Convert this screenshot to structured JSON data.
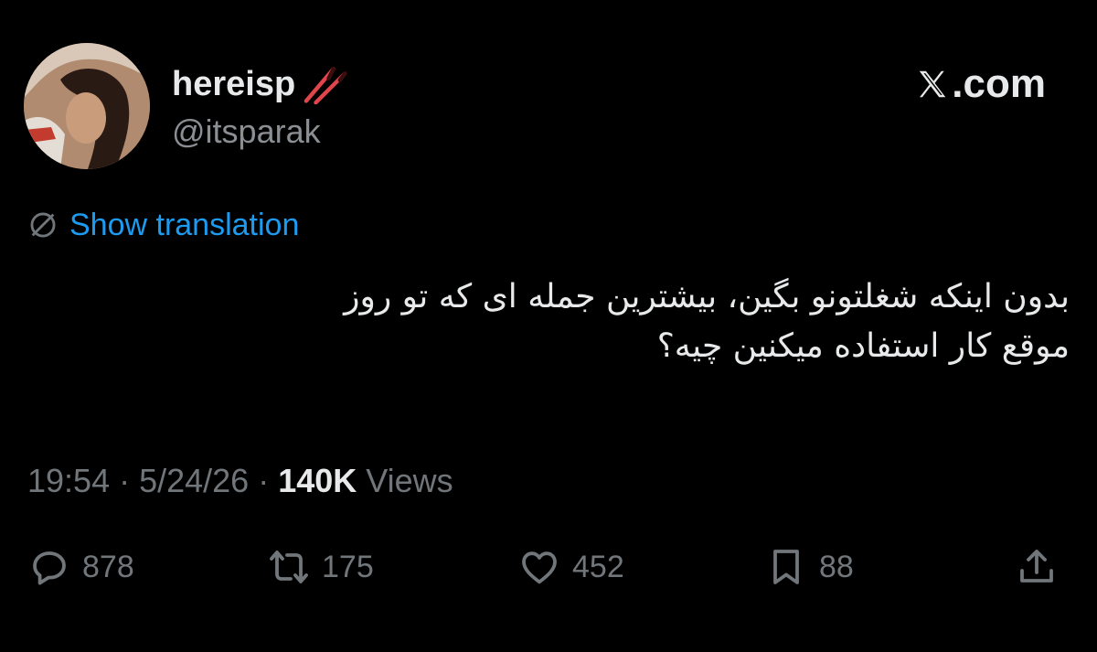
{
  "author": {
    "display_name": "hereisp",
    "handle": "@itsparak",
    "avatar_icon": "profile-photo",
    "name_emoji_icon": "chopsticks-icon"
  },
  "site": {
    "logo_text": ".com",
    "logo_icon": "x-logo-icon"
  },
  "translation": {
    "label": "Show translation",
    "icon": "globe-translate-icon"
  },
  "tweet": {
    "text_line1": "بدون اینکه شغلتونو بگین، بیشترین جمله ای که تو روز",
    "text_line2": "موقع کار استفاده میکنین چیه؟"
  },
  "meta": {
    "time": "19:54",
    "sep1": "·",
    "date": "5/24/26",
    "sep2": "·",
    "views_count": "140K",
    "views_label": "Views"
  },
  "actions": {
    "replies": "878",
    "reposts": "175",
    "likes": "452",
    "bookmarks": "88"
  },
  "colors": {
    "background": "#000000",
    "text_primary": "#e7e9ea",
    "text_secondary": "#71767b",
    "link": "#1d9bf0"
  }
}
